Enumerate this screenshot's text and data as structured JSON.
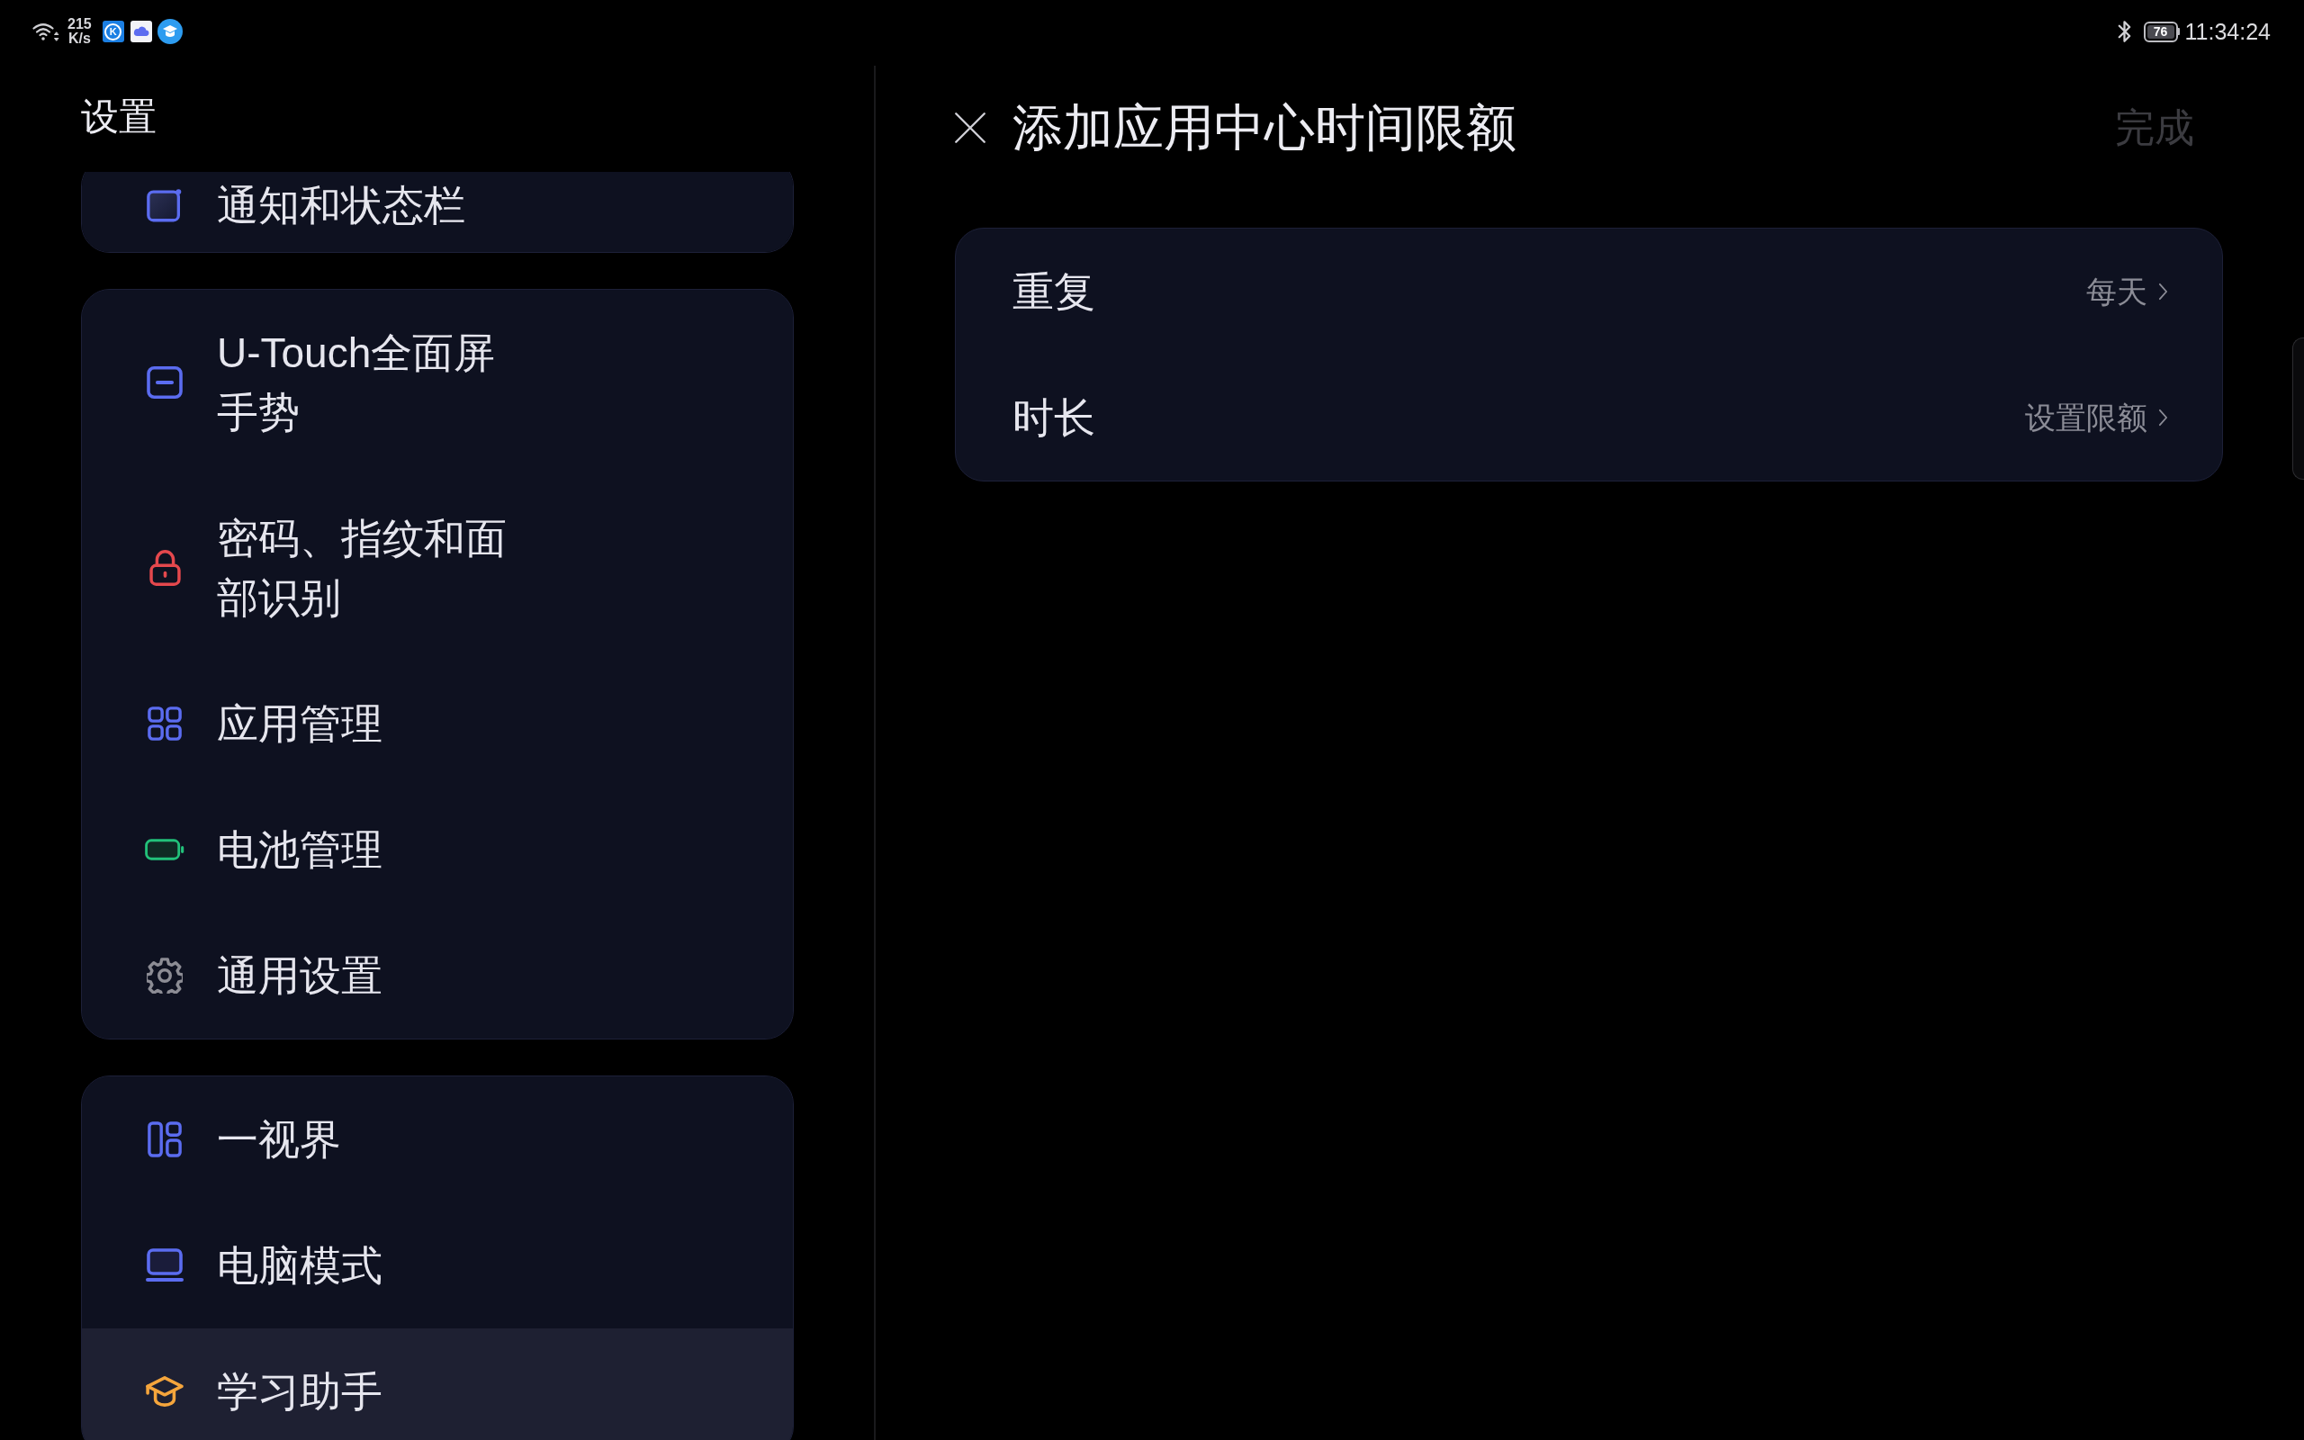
{
  "status_bar": {
    "network_speed": {
      "value": "215",
      "unit": "K/s"
    },
    "app_badge_text": "K",
    "battery_text": "76",
    "time": "11:34:24"
  },
  "sidebar": {
    "title": "设置",
    "groups": [
      {
        "items": [
          {
            "label": "通知和状态栏",
            "selected": false
          }
        ]
      },
      {
        "items": [
          {
            "label": "U-Touch全面屏手势",
            "selected": false
          },
          {
            "label": "密码、指纹和面部识别",
            "selected": false
          },
          {
            "label": "应用管理",
            "selected": false
          },
          {
            "label": "电池管理",
            "selected": false
          },
          {
            "label": "通用设置",
            "selected": false
          }
        ]
      },
      {
        "items": [
          {
            "label": "一视界",
            "selected": false
          },
          {
            "label": "电脑模式",
            "selected": false
          },
          {
            "label": "学习助手",
            "selected": true
          }
        ]
      }
    ]
  },
  "detail": {
    "title": "添加应用中心时间限额",
    "done_button": {
      "label": "完成",
      "disabled": true
    },
    "rows": [
      {
        "label": "重复",
        "value": "每天"
      },
      {
        "label": "时长",
        "value": "设置限额"
      }
    ]
  }
}
